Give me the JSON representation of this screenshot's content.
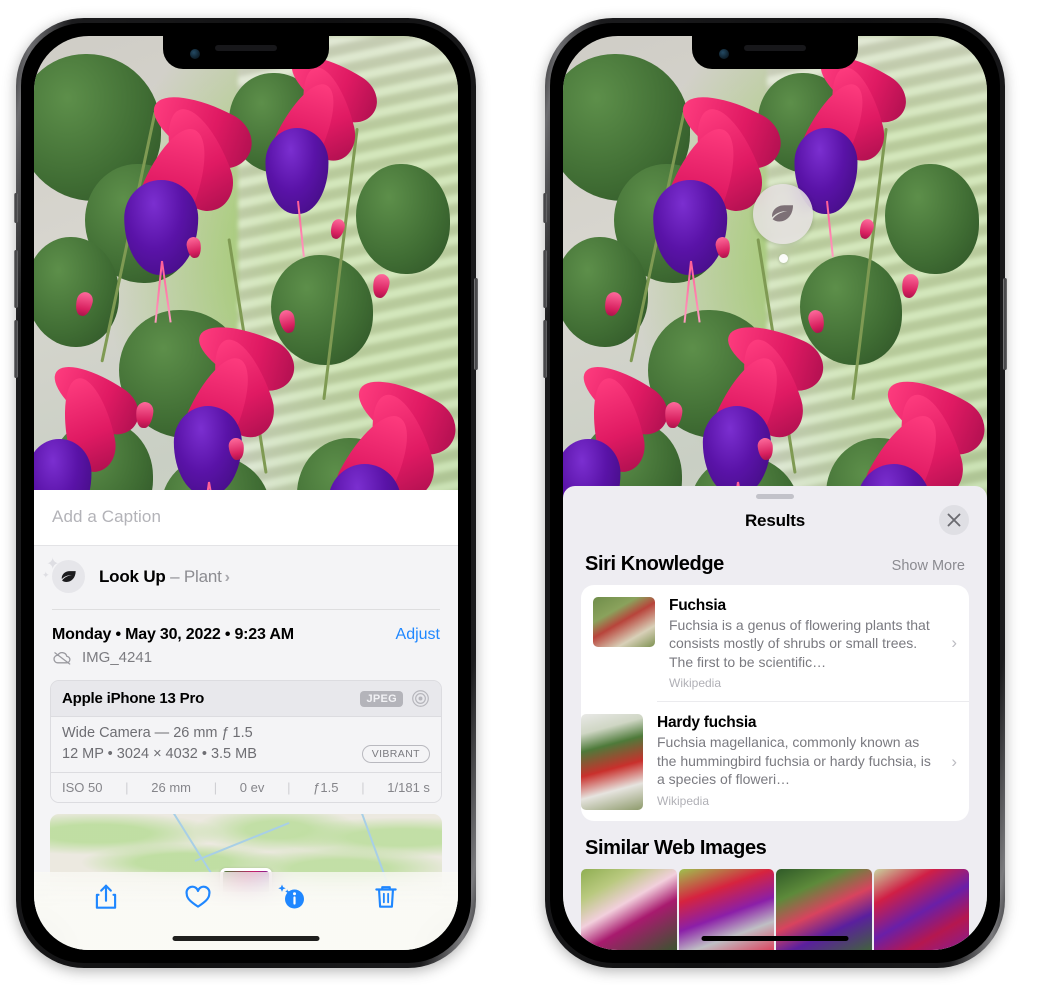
{
  "left_phone": {
    "photo": {
      "alt_name": "fuchsia-flowers-photo"
    },
    "caption": {
      "placeholder": "Add a Caption",
      "value": ""
    },
    "look_up": {
      "icon": "leaf-icon",
      "label": "Look Up",
      "dash": " – ",
      "subject": "Plant",
      "chevron": "›"
    },
    "date_row": {
      "date_text": "Monday • May 30, 2022 • 9:23 AM",
      "adjust_label": "Adjust"
    },
    "file_row": {
      "icon": "cloud-slash-icon",
      "filename": "IMG_4241"
    },
    "exif": {
      "device": "Apple iPhone 13 Pro",
      "format_badge": "JPEG",
      "aperture_icon": "aperture-icon",
      "lens_line": "Wide Camera — 26 mm ƒ 1.5",
      "size_line": "12 MP • 3024 × 4032 • 3.5 MB",
      "style_badge": "VIBRANT",
      "stats": [
        "ISO 50",
        "26 mm",
        "0 ev",
        "ƒ1.5",
        "1/181 s"
      ],
      "separator": "|"
    },
    "map": {
      "name": "location-map-thumbnail",
      "pin": "photo-pin"
    },
    "toolbar": [
      {
        "name": "share-icon",
        "label": "Share"
      },
      {
        "name": "favorite-heart-icon",
        "label": "Favorite"
      },
      {
        "name": "info-sparkle-icon",
        "label": "Info",
        "active": true
      },
      {
        "name": "trash-icon",
        "label": "Delete"
      }
    ]
  },
  "right_phone": {
    "visual_look_up_badge": {
      "icon": "leaf-icon",
      "name": "visual-look-up-badge"
    },
    "sheet": {
      "grabber": "sheet-grabber",
      "title": "Results",
      "close_icon": "close-icon"
    },
    "siri_knowledge": {
      "heading": "Siri Knowledge",
      "show_more": "Show More",
      "items": [
        {
          "title": "Fuchsia",
          "description": "Fuchsia is a genus of flowering plants that consists mostly of shrubs or small trees. The first to be scientific…",
          "source": "Wikipedia",
          "chevron": "›",
          "thumb": "fuchsia-thumbnail"
        },
        {
          "title": "Hardy fuchsia",
          "description": "Fuchsia magellanica, commonly known as the hummingbird fuchsia or hardy fuchsia, is a species of floweri…",
          "source": "Wikipedia",
          "chevron": "›",
          "thumb": "hardy-fuchsia-thumbnail"
        }
      ]
    },
    "similar_web_images": {
      "heading": "Similar Web Images",
      "tiles": [
        {
          "name": "similar-image-1"
        },
        {
          "name": "similar-image-2"
        },
        {
          "name": "similar-image-3"
        },
        {
          "name": "similar-image-4"
        }
      ]
    }
  },
  "colors": {
    "accent_blue": "#1f87ff",
    "sheet_bg": "#f4f4f6",
    "results_bg": "#eeedf2",
    "card_white": "#ffffff",
    "secondary_text": "#8c8c91"
  }
}
